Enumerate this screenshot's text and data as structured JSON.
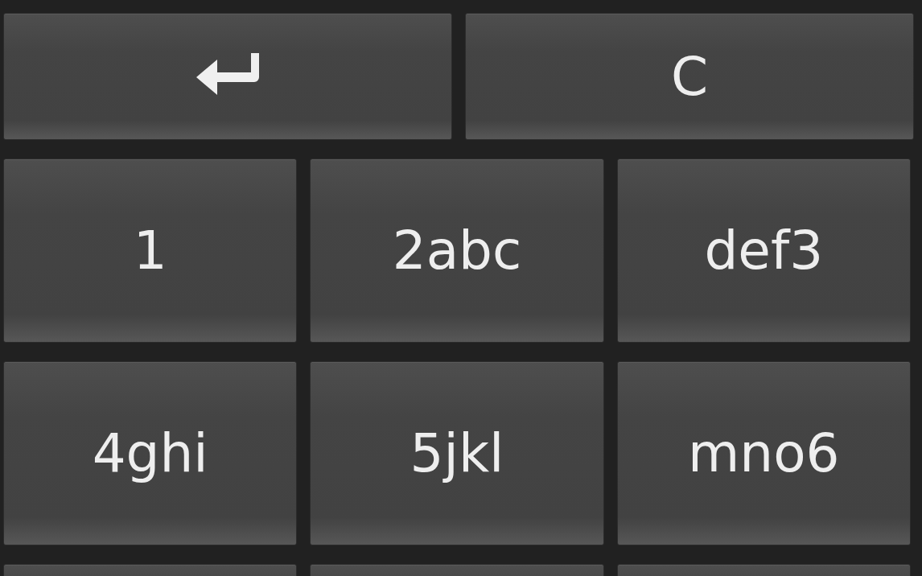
{
  "keypad": {
    "rows": [
      [
        {
          "kind": "enter"
        },
        {
          "kind": "text",
          "label": "C"
        }
      ],
      [
        {
          "kind": "text",
          "label": "1"
        },
        {
          "kind": "text",
          "label": "2abc"
        },
        {
          "kind": "text",
          "label": "def3"
        }
      ],
      [
        {
          "kind": "text",
          "label": "4ghi"
        },
        {
          "kind": "text",
          "label": "5jkl"
        },
        {
          "kind": "text",
          "label": "mno6"
        }
      ],
      [
        {
          "kind": "blank"
        },
        {
          "kind": "blank"
        },
        {
          "kind": "blank"
        }
      ]
    ]
  }
}
